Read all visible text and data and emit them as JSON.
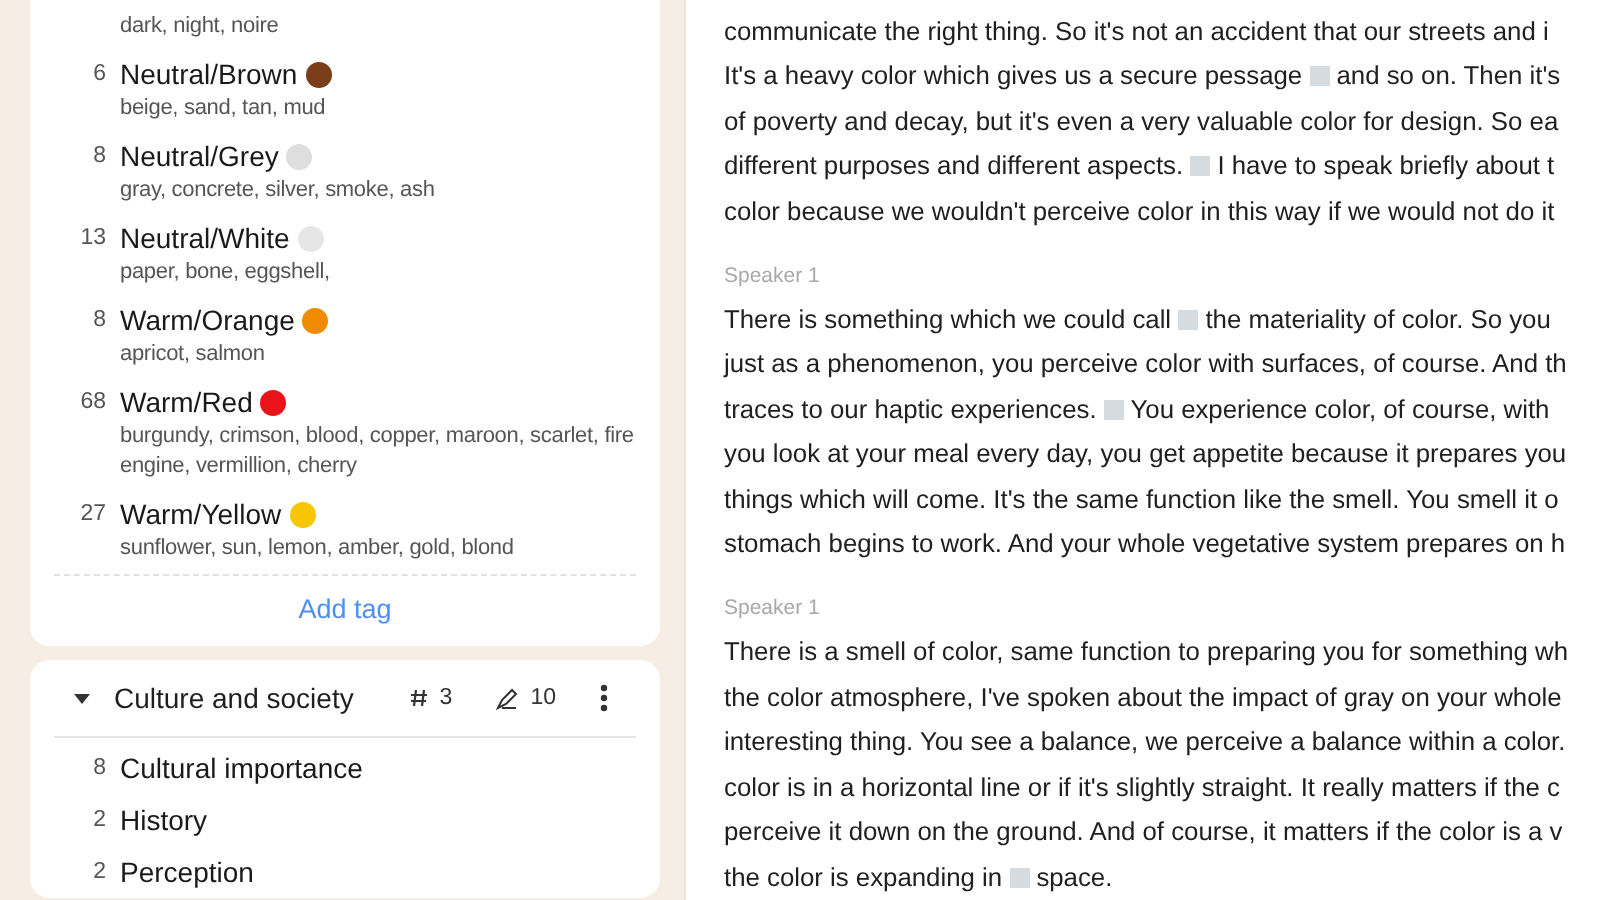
{
  "tag_groups": [
    {
      "tags": [
        {
          "synonyms": "dark, night, noire"
        },
        {
          "count": "6",
          "name": "Neutral/Brown",
          "color": "#7a3e1a",
          "synonyms": "beige, sand, tan, mud"
        },
        {
          "count": "8",
          "name": "Neutral/Grey",
          "color": "#dedede",
          "synonyms": "gray, concrete, silver, smoke, ash"
        },
        {
          "count": "13",
          "name": "Neutral/White",
          "color": "#e6e6e6",
          "synonyms": "paper, bone, eggshell,"
        },
        {
          "count": "8",
          "name": "Warm/Orange",
          "color": "#f08a00",
          "synonyms": "apricot, salmon"
        },
        {
          "count": "68",
          "name": "Warm/Red",
          "color": "#e8141a",
          "synonyms": "burgundy, crimson, blood, copper, maroon, scarlet, fire engine, vermillion, cherry"
        },
        {
          "count": "27",
          "name": "Warm/Yellow",
          "color": "#f7c600",
          "synonyms": "sunflower, sun, lemon, amber, gold, blond"
        }
      ],
      "add_label": "Add tag"
    },
    {
      "title": "Culture and society",
      "expanded": true,
      "tag_count": "3",
      "mention_count": "10",
      "tags": [
        {
          "count": "8",
          "name": "Cultural importance"
        },
        {
          "count": "2",
          "name": "History"
        },
        {
          "count": "2",
          "name": "Perception"
        }
      ]
    }
  ],
  "transcript": [
    {
      "lines": [
        [
          {
            "kind": "text",
            "text": "communicate the right thing. So it's not an accident that our streets and i"
          }
        ],
        [
          {
            "kind": "text",
            "text": "It's a heavy color which gives us a secure pessage "
          },
          {
            "kind": "mark"
          },
          {
            "kind": "text",
            "text": " and so on. Then it's"
          }
        ],
        [
          {
            "kind": "text",
            "text": "of poverty and decay, but it's even a very valuable color for design. So ea"
          }
        ],
        [
          {
            "kind": "text",
            "text": "different purposes and different aspects. "
          },
          {
            "kind": "mark"
          },
          {
            "kind": "text",
            "text": " I have to speak briefly about t"
          }
        ],
        [
          {
            "kind": "text",
            "text": "color because we wouldn't perceive color in this way if we would not do it"
          }
        ]
      ]
    },
    {
      "speaker": "Speaker 1",
      "lines": [
        [
          {
            "kind": "text",
            "text": "There is something which we could call "
          },
          {
            "kind": "mark"
          },
          {
            "kind": "text",
            "text": " the materiality of color. So you"
          }
        ],
        [
          {
            "kind": "text",
            "text": "just as a phenomenon, you perceive color with surfaces, of course. And th"
          }
        ],
        [
          {
            "kind": "text",
            "text": "traces to our haptic experiences. "
          },
          {
            "kind": "mark"
          },
          {
            "kind": "text",
            "text": " You experience color, of course, with"
          }
        ],
        [
          {
            "kind": "text",
            "text": "you look at your meal every day, you get appetite because it prepares you"
          }
        ],
        [
          {
            "kind": "text",
            "text": "things which will come. It's the same function like the smell. You smell it o"
          }
        ],
        [
          {
            "kind": "text",
            "text": "stomach begins to work. And your whole vegetative system prepares on h"
          }
        ]
      ]
    },
    {
      "speaker": "Speaker 1",
      "lines": [
        [
          {
            "kind": "text",
            "text": "There is a smell of color, same function to preparing you for something wh"
          }
        ],
        [
          {
            "kind": "text",
            "text": "the color atmosphere, I've spoken about the impact of gray on your whole"
          }
        ],
        [
          {
            "kind": "text",
            "text": "interesting thing. You see a balance, we perceive a balance within a color."
          }
        ],
        [
          {
            "kind": "text",
            "text": "color is in a horizontal line or if it's slightly straight. It really matters if the c"
          }
        ],
        [
          {
            "kind": "text",
            "text": "perceive it down on the ground. And of course, it matters if the color is a v"
          }
        ],
        [
          {
            "kind": "text",
            "text": "the color is expanding in "
          },
          {
            "kind": "mark"
          },
          {
            "kind": "text",
            "text": " space."
          }
        ]
      ]
    }
  ]
}
